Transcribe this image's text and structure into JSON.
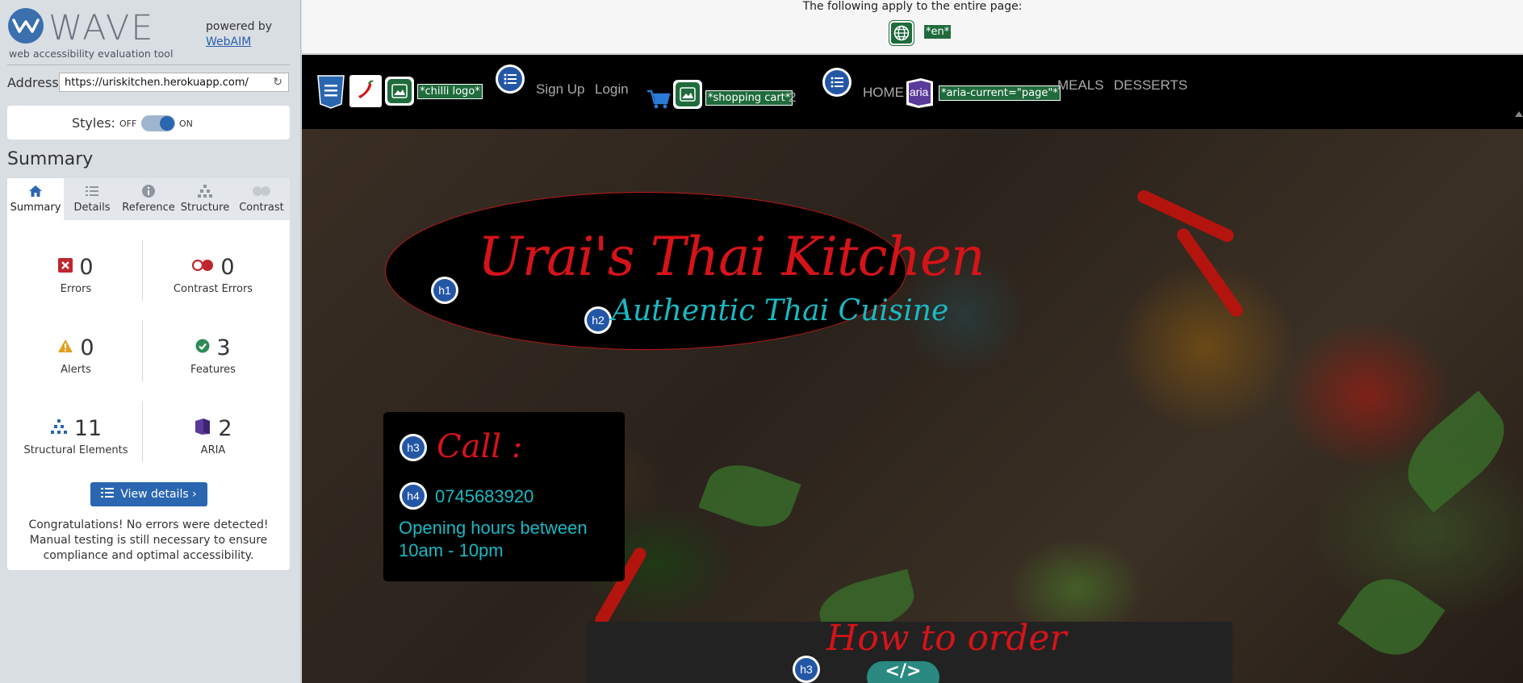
{
  "wave": {
    "brand": "WAVE",
    "tagline": "web accessibility evaluation tool",
    "powered_by": "powered by",
    "webaim_link": "WebAIM",
    "address_label": "Address:",
    "address_value": "https://uriskitchen.herokuapp.com/",
    "styles_label": "Styles:",
    "styles_off": "OFF",
    "styles_on": "ON",
    "styles_enabled": true,
    "summary_title": "Summary",
    "tabs": [
      {
        "label": "Summary",
        "icon": "home-icon",
        "active": true
      },
      {
        "label": "Details",
        "icon": "list-icon",
        "active": false
      },
      {
        "label": "Reference",
        "icon": "info-icon",
        "active": false
      },
      {
        "label": "Structure",
        "icon": "hierarchy-icon",
        "active": false
      },
      {
        "label": "Contrast",
        "icon": "contrast-icon",
        "active": false
      }
    ],
    "stats": {
      "errors": {
        "count": "0",
        "label": "Errors",
        "color": "#c0262d"
      },
      "contrast_errors": {
        "count": "0",
        "label": "Contrast Errors",
        "color": "#c0262d"
      },
      "alerts": {
        "count": "0",
        "label": "Alerts",
        "color": "#e0a020"
      },
      "features": {
        "count": "3",
        "label": "Features",
        "color": "#2e8b57"
      },
      "structural": {
        "count": "11",
        "label": "Structural Elements",
        "color": "#2b66b0"
      },
      "aria": {
        "count": "2",
        "label": "ARIA",
        "color": "#5a3a9a"
      }
    },
    "view_details": "View details ›",
    "congrats": "Congratulations! No errors were detected! Manual testing is still necessary to ensure compliance and optimal accessibility."
  },
  "pagebar": {
    "text": "The following apply to the entire page:",
    "lang_tag": "*en*"
  },
  "site": {
    "nav": {
      "logo_tag": "*chilli logo*",
      "sign_up": "Sign Up",
      "login": "Login",
      "cart_tag": "*shopping cart*",
      "cart_count": "2",
      "home": "HOME",
      "aria_label": "aria",
      "aria_current_tag": "*aria-current=\"page\"*",
      "meals": "MEALS",
      "desserts": "DESSERTS"
    },
    "hero": {
      "h1_badge": "h1",
      "h1": "Urai's Thai Kitchen",
      "h2_badge": "h2",
      "h2": "Authentic Thai Cuisine",
      "h3_badge": "h3",
      "call": "Call :",
      "h4_badge": "h4",
      "phone": "0745683920",
      "hours": "Opening hours between 10am - 10pm",
      "order_badge": "h3",
      "order_title": "How to order",
      "code_icon": "</>"
    },
    "colors": {
      "title_red": "#d41419",
      "teal": "#1bb8c2",
      "wave_blue": "#2357a6",
      "wave_green": "#1f6b3c"
    }
  }
}
